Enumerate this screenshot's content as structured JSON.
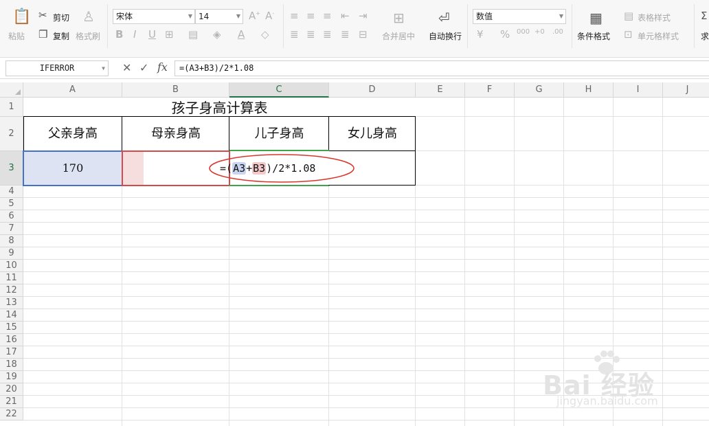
{
  "ribbon": {
    "paste": "粘贴",
    "cut": "剪切",
    "copy": "复制",
    "format_painter": "格式刷",
    "font_name": "宋体",
    "font_size": "14",
    "merge_center": "合并居中",
    "wrap_text": "自动换行",
    "number_format": "数值",
    "conditional_format": "条件格式",
    "table_style": "表格样式",
    "cell_style": "单元格样式",
    "sum": "求"
  },
  "formula_bar": {
    "name_box": "IFERROR",
    "cancel": "✕",
    "enter": "✓",
    "fx": "fx",
    "formula": "=(A3+B3)/2*1.08"
  },
  "grid": {
    "columns": [
      "A",
      "B",
      "C",
      "D",
      "E",
      "F",
      "G",
      "H",
      "I",
      "J"
    ],
    "rows": [
      "1",
      "2",
      "3",
      "4",
      "5",
      "6",
      "7",
      "8",
      "9",
      "10",
      "11",
      "12",
      "13",
      "14",
      "15",
      "16",
      "17",
      "18",
      "19",
      "20",
      "21",
      "22"
    ],
    "title": "孩子身高计算表",
    "headers": [
      "父亲身高",
      "母亲身高",
      "儿子身高",
      "女儿身高"
    ],
    "a3_value": "170",
    "edit_formula": {
      "prefix": "=(",
      "ref_a": "A3",
      "plus": "+",
      "ref_b": "B3",
      "suffix": ")/2*1.08"
    }
  },
  "watermark": {
    "brand": "Bai 经验",
    "url": "jingyan.baidu.com"
  }
}
